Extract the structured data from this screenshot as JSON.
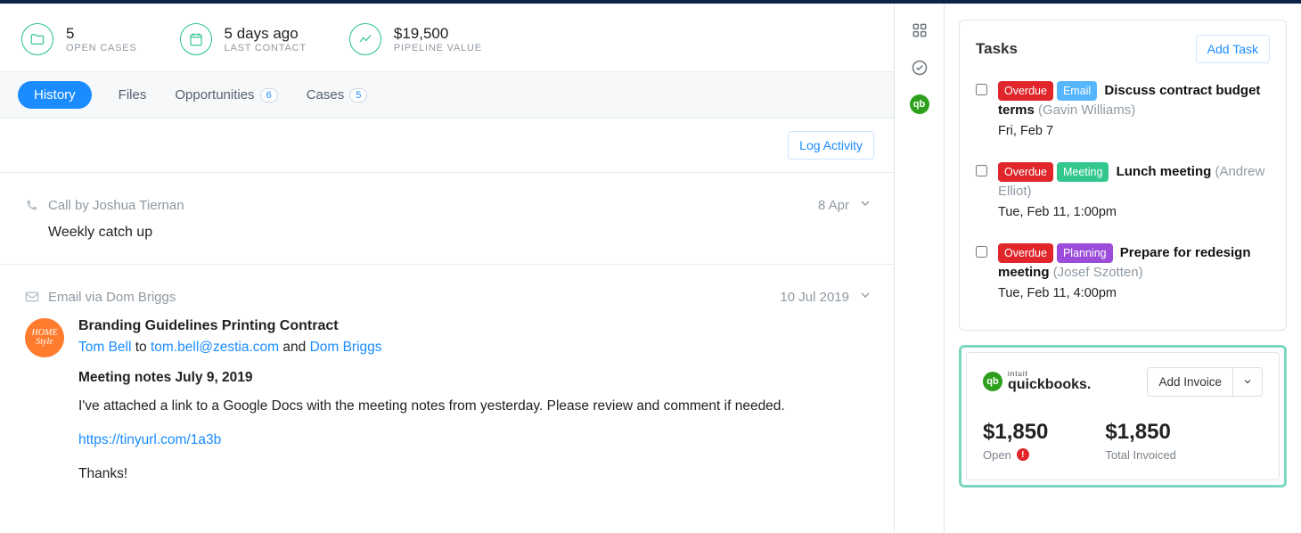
{
  "stats": {
    "open_cases": {
      "value": "5",
      "label": "OPEN CASES"
    },
    "last_contact": {
      "value": "5 days ago",
      "label": "LAST CONTACT"
    },
    "pipeline": {
      "value": "$19,500",
      "label": "PIPELINE VALUE"
    }
  },
  "tabs": {
    "history": "History",
    "files": "Files",
    "opportunities": {
      "label": "Opportunities",
      "count": "6"
    },
    "cases": {
      "label": "Cases",
      "count": "5"
    }
  },
  "actions": {
    "log_activity": "Log Activity"
  },
  "feed": {
    "call": {
      "header": "Call by Joshua Tiernan",
      "date": "8 Apr",
      "title": "Weekly catch up"
    },
    "email": {
      "header": "Email via Dom Briggs",
      "date": "10 Jul 2019",
      "avatar_text": "HOME Style",
      "subject": "Branding Guidelines Printing Contract",
      "from_name": "Tom Bell",
      "to_word": " to ",
      "to_email": "tom.bell@zestia.com",
      "and_word": " and ",
      "cc_name": "Dom Briggs",
      "notes_heading": "Meeting notes July 9, 2019",
      "body_1": "I've attached a link to a Google Docs with the meeting notes from yesterday. Please review and comment if needed.",
      "link": "https://tinyurl.com/1a3b",
      "body_2": "Thanks!"
    }
  },
  "tasks": {
    "header": "Tasks",
    "add_button": "Add Task",
    "items": [
      {
        "tag1": "Overdue",
        "tag1_class": "overdue",
        "tag2": "Email",
        "tag2_class": "email",
        "title": "Discuss contract budget terms",
        "assignee": "(Gavin Williams)",
        "date": "Fri, Feb 7"
      },
      {
        "tag1": "Overdue",
        "tag1_class": "overdue",
        "tag2": "Meeting",
        "tag2_class": "meeting",
        "title": "Lunch meeting",
        "assignee": "(Andrew Elliot)",
        "date": "Tue, Feb 11, 1:00pm"
      },
      {
        "tag1": "Overdue",
        "tag1_class": "overdue",
        "tag2": "Planning",
        "tag2_class": "planning",
        "title": "Prepare for redesign meeting",
        "assignee": "(Josef Szotten)",
        "date": "Tue, Feb 11, 4:00pm"
      }
    ]
  },
  "quickbooks": {
    "intuit": "intuit",
    "name": "quickbooks.",
    "add_invoice": "Add Invoice",
    "open_amount": "$1,850",
    "open_label": "Open",
    "total_amount": "$1,850",
    "total_label": "Total Invoiced"
  }
}
